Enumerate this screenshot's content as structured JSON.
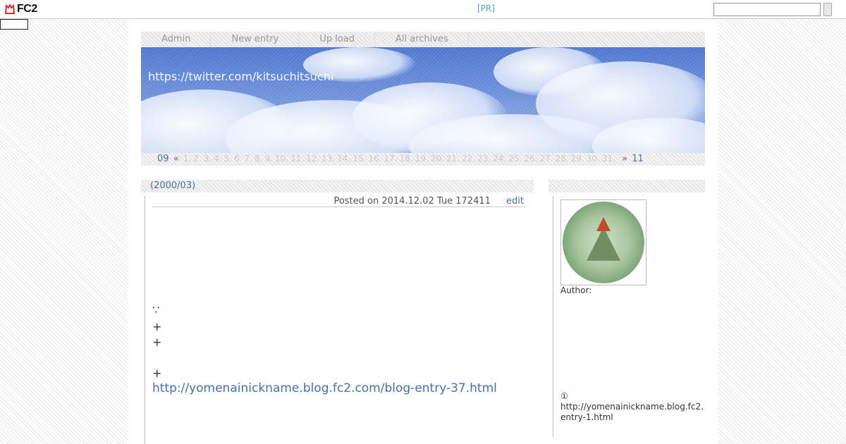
{
  "fc2": {
    "logo_text": "FC2",
    "pr_label": "[PR]",
    "search_value": ""
  },
  "menu": [
    "Admin",
    "New entry",
    "Up load",
    "All archives"
  ],
  "header": {
    "site_title": "https://twitter.com/kitsuchitsuchi"
  },
  "calendar": {
    "prev_month": "09",
    "prev_arrow": "«",
    "next_arrow": "»",
    "next_month": "11",
    "days": [
      "1.",
      "2.",
      "3.",
      "4.",
      "5.",
      "6.",
      "7.",
      "8.",
      "9.",
      "10.",
      "11.",
      "12.",
      "13.",
      "14.",
      "15.",
      "16.",
      "17.",
      "18.",
      "19.",
      "20.",
      "21.",
      "22.",
      "23.",
      "24.",
      "25.",
      "26.",
      "27.",
      "28.",
      "29.",
      "30.",
      "31."
    ]
  },
  "entry": {
    "title": "(2000/03)",
    "posted": "Posted on 2014.12.02 Tue 172411",
    "edit_label": "edit",
    "lines": [
      "∵",
      "+",
      "+",
      "+"
    ],
    "link": "http://yomenainickname.blog.fc2.com/blog-entry-37.html"
  },
  "sidebar": {
    "author_label": "Author:",
    "note_mark": "①",
    "note_line1": "http://yomenainickname.blog.fc2.",
    "note_line2": "entry-1.html"
  },
  "colors": {
    "link": "#4a6fa5",
    "pr": "#5aa0d0"
  }
}
